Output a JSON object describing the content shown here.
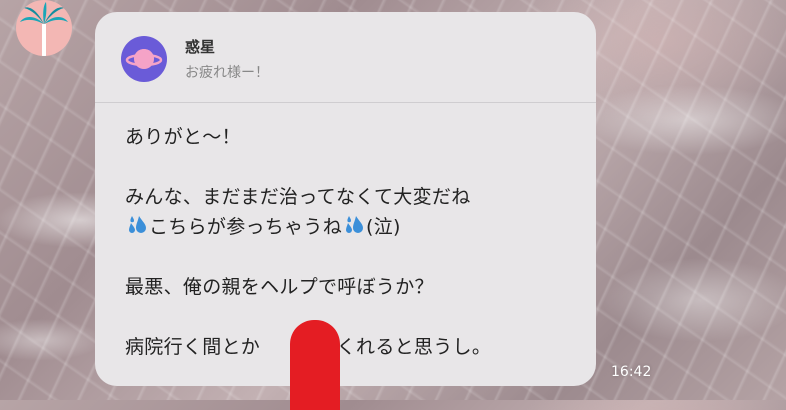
{
  "chat": {
    "contact_avatar_icon": "palm-tree-icon",
    "quoted": {
      "sender": "惑星",
      "preview": "お疲れ様ー！",
      "avatar_icon": "planet-icon",
      "avatar_color": "#6a5bd8"
    },
    "message": {
      "line1": "ありがと〜！",
      "line2": "みんな、まだまだ治ってなくて大変だね",
      "line3_a": "こちらが参っちゃうね",
      "line3_b": "(泣)",
      "line4": "最悪、俺の親をヘルプで呼ぼうか？",
      "line5": "病院行く間とか　　見てくれると思うし。",
      "emoji": "sweat-droplets-icon"
    },
    "time": "16:42",
    "redaction_color": "#e41d23"
  }
}
